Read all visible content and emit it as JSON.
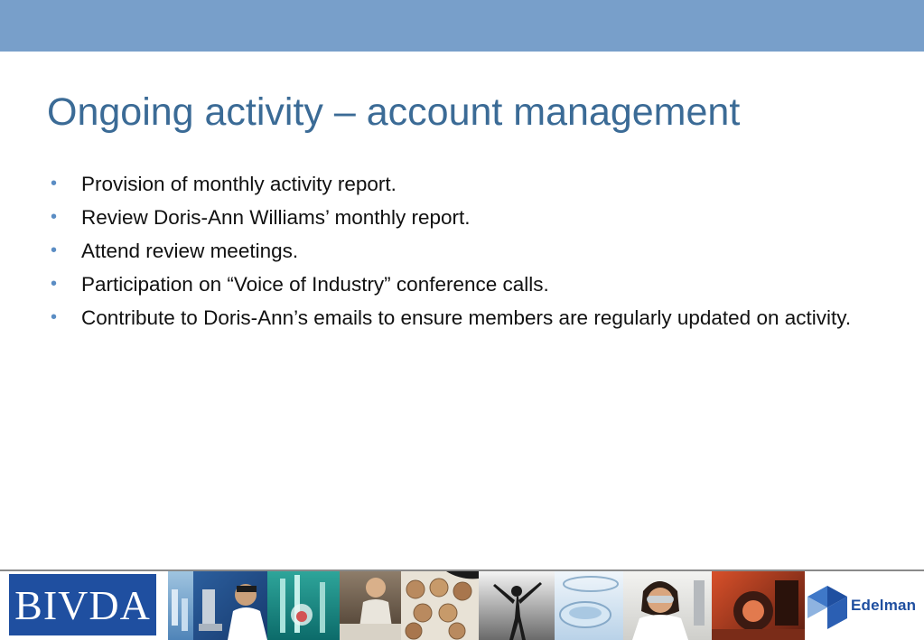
{
  "slide": {
    "title": "Ongoing activity – account management",
    "bullets": [
      "Provision of monthly activity report.",
      "Review Doris-Ann Williams’ monthly report.",
      "Attend review meetings.",
      "Participation on “Voice of Industry” conference calls.",
      "Contribute to Doris-Ann’s emails to ensure members are regularly updated on activity."
    ]
  },
  "footer": {
    "left_logo_text": "BIVDA",
    "right_logo_text": "Edelman"
  },
  "colors": {
    "band": "#789fca",
    "title": "#3b6b96",
    "bullet": "#5b8dc4",
    "logo_blue": "#1f4fa0"
  }
}
